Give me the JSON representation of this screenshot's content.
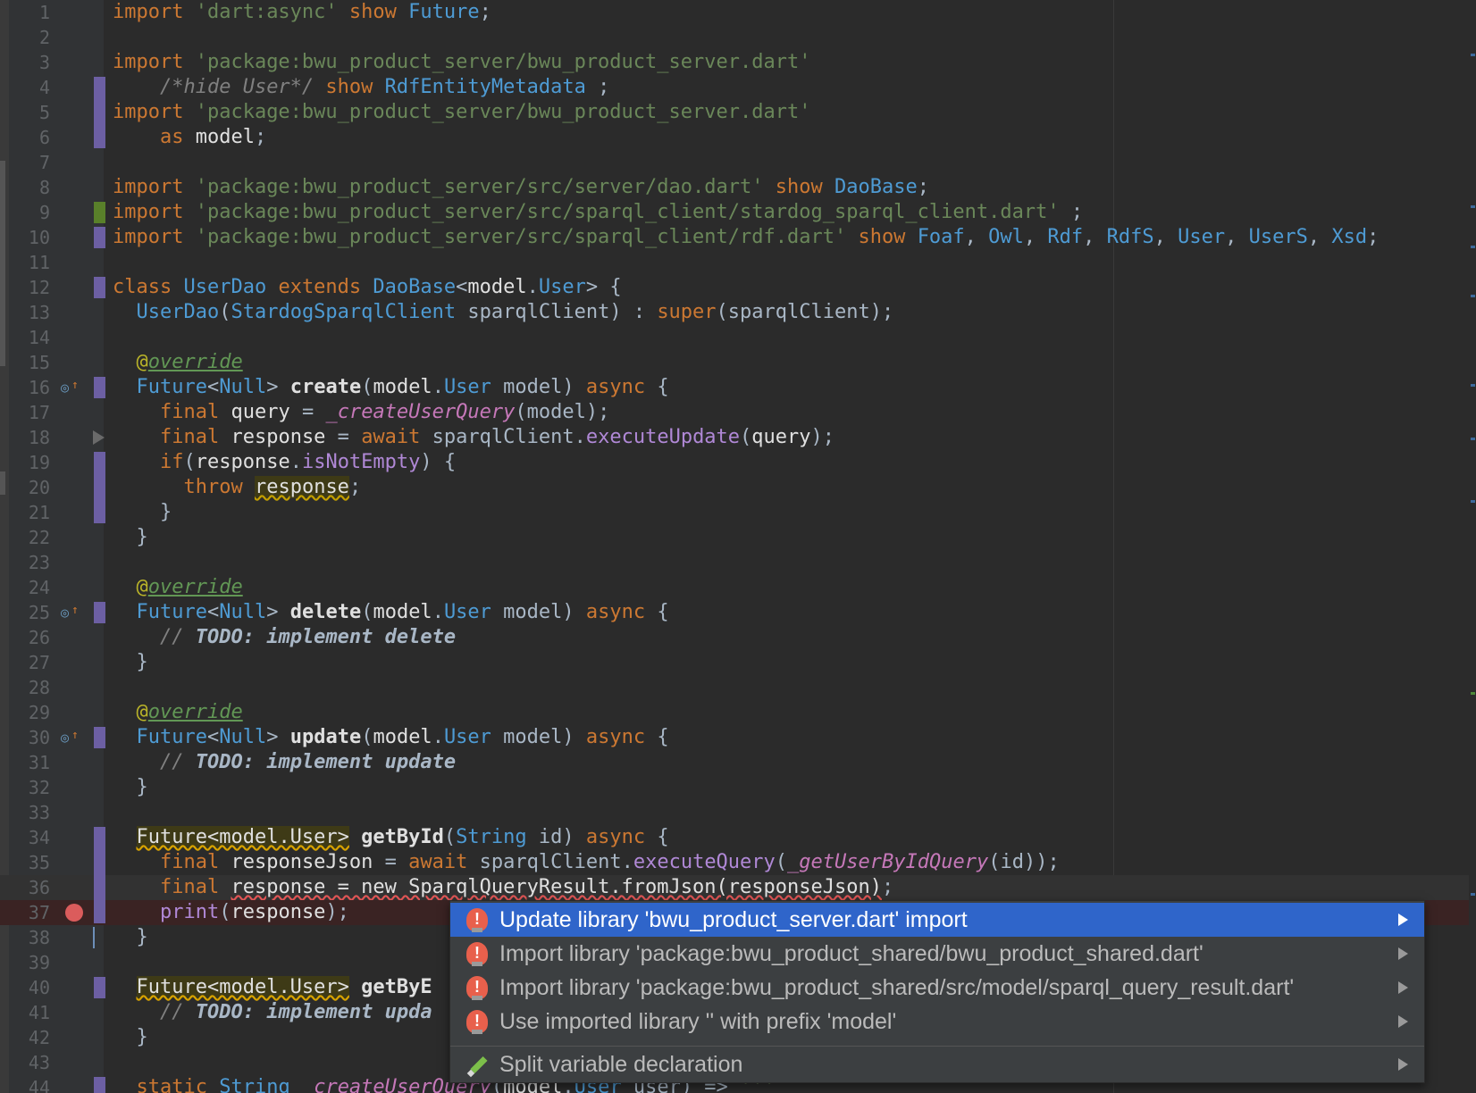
{
  "editor": {
    "lines": [
      {
        "n": "1",
        "tokens": [
          [
            "kw",
            "import "
          ],
          [
            "str",
            "'dart:async'"
          ],
          [
            "kw",
            " show "
          ],
          [
            "cls",
            "Future"
          ],
          [
            "plain",
            ";"
          ]
        ]
      },
      {
        "n": "2",
        "tokens": []
      },
      {
        "n": "3",
        "tokens": [
          [
            "kw",
            "import "
          ],
          [
            "str",
            "'package:bwu_product_server/bwu_product_server.dart'"
          ]
        ]
      },
      {
        "n": "4",
        "tokens": [
          [
            "plain",
            "    "
          ],
          [
            "comment",
            "/*hide User*/"
          ],
          [
            "kw",
            " show "
          ],
          [
            "cls",
            "RdfEntityMetadata"
          ],
          [
            "plain",
            " ;"
          ]
        ]
      },
      {
        "n": "5",
        "tokens": [
          [
            "kw",
            "import "
          ],
          [
            "str",
            "'package:bwu_product_server/bwu_product_server.dart'"
          ]
        ]
      },
      {
        "n": "6",
        "tokens": [
          [
            "plain",
            "    "
          ],
          [
            "kw",
            "as "
          ],
          [
            "white",
            "model"
          ],
          [
            "plain",
            ";"
          ]
        ]
      },
      {
        "n": "7",
        "tokens": []
      },
      {
        "n": "8",
        "tokens": [
          [
            "kw",
            "import "
          ],
          [
            "str",
            "'package:bwu_product_server/src/server/dao.dart'"
          ],
          [
            "kw",
            " show "
          ],
          [
            "cls",
            "DaoBase"
          ],
          [
            "plain",
            ";"
          ]
        ]
      },
      {
        "n": "9",
        "tokens": [
          [
            "kw",
            "import "
          ],
          [
            "str",
            "'package:bwu_product_server/src/sparql_client/stardog_sparql_client.dart'"
          ],
          [
            "plain",
            " ;"
          ]
        ]
      },
      {
        "n": "10",
        "tokens": [
          [
            "kw",
            "import "
          ],
          [
            "str",
            "'package:bwu_product_server/src/sparql_client/rdf.dart'"
          ],
          [
            "kw",
            " show "
          ],
          [
            "cls",
            "Foaf"
          ],
          [
            "plain",
            ", "
          ],
          [
            "cls",
            "Owl"
          ],
          [
            "plain",
            ", "
          ],
          [
            "cls",
            "Rdf"
          ],
          [
            "plain",
            ", "
          ],
          [
            "cls",
            "RdfS"
          ],
          [
            "plain",
            ", "
          ],
          [
            "cls",
            "User"
          ],
          [
            "plain",
            ", "
          ],
          [
            "cls",
            "UserS"
          ],
          [
            "plain",
            ", "
          ],
          [
            "cls",
            "Xsd"
          ],
          [
            "plain",
            ";"
          ]
        ]
      },
      {
        "n": "11",
        "tokens": []
      },
      {
        "n": "12",
        "tokens": [
          [
            "kw",
            "class "
          ],
          [
            "cls",
            "UserDao"
          ],
          [
            "kw",
            " extends "
          ],
          [
            "cls",
            "DaoBase"
          ],
          [
            "plain",
            "<"
          ],
          [
            "white",
            "model"
          ],
          [
            "plain",
            "."
          ],
          [
            "cls",
            "User"
          ],
          [
            "plain",
            "> {"
          ]
        ]
      },
      {
        "n": "13",
        "tokens": [
          [
            "plain",
            "  "
          ],
          [
            "cls",
            "UserDao"
          ],
          [
            "plain",
            "("
          ],
          [
            "cls",
            "StardogSparqlClient"
          ],
          [
            "plain",
            " sparqlClient) : "
          ],
          [
            "kw",
            "super"
          ],
          [
            "plain",
            "(sparqlClient);"
          ]
        ]
      },
      {
        "n": "14",
        "tokens": []
      },
      {
        "n": "15",
        "tokens": [
          [
            "plain",
            "  "
          ],
          [
            "ann",
            "@"
          ],
          [
            "annname",
            "override"
          ]
        ]
      },
      {
        "n": "16",
        "tokens": [
          [
            "plain",
            "  "
          ],
          [
            "cls",
            "Future"
          ],
          [
            "plain",
            "<"
          ],
          [
            "cls",
            "Null"
          ],
          [
            "plain",
            "> "
          ],
          [
            "fn",
            "create"
          ],
          [
            "plain",
            "("
          ],
          [
            "white",
            "model"
          ],
          [
            "plain",
            "."
          ],
          [
            "cls",
            "User"
          ],
          [
            "plain",
            " model) "
          ],
          [
            "kw",
            "async"
          ],
          [
            "plain",
            " {"
          ]
        ]
      },
      {
        "n": "17",
        "tokens": [
          [
            "plain",
            "    "
          ],
          [
            "kw",
            "final "
          ],
          [
            "white",
            "query"
          ],
          [
            "plain",
            " = "
          ],
          [
            "priv",
            "_createUserQuery"
          ],
          [
            "plain",
            "(model);"
          ]
        ]
      },
      {
        "n": "18",
        "tokens": [
          [
            "plain",
            "    "
          ],
          [
            "kw",
            "final "
          ],
          [
            "white",
            "response"
          ],
          [
            "plain",
            " = "
          ],
          [
            "kw",
            "await "
          ],
          [
            "plain",
            "sparqlClient."
          ],
          [
            "call",
            "executeUpdate"
          ],
          [
            "plain",
            "("
          ],
          [
            "white",
            "query"
          ],
          [
            "plain",
            ");"
          ]
        ]
      },
      {
        "n": "19",
        "tokens": [
          [
            "plain",
            "    "
          ],
          [
            "kw",
            "if"
          ],
          [
            "plain",
            "("
          ],
          [
            "white",
            "response"
          ],
          [
            "plain",
            "."
          ],
          [
            "call",
            "isNotEmpty"
          ],
          [
            "plain",
            ") {"
          ]
        ]
      },
      {
        "n": "20",
        "tokens": [
          [
            "plain",
            "      "
          ],
          [
            "kw",
            "throw "
          ],
          [
            "warn",
            "response"
          ],
          [
            "plain",
            ";"
          ]
        ]
      },
      {
        "n": "21",
        "tokens": [
          [
            "plain",
            "    }"
          ]
        ]
      },
      {
        "n": "22",
        "tokens": [
          [
            "plain",
            "  }"
          ]
        ]
      },
      {
        "n": "23",
        "tokens": []
      },
      {
        "n": "24",
        "tokens": [
          [
            "plain",
            "  "
          ],
          [
            "ann",
            "@"
          ],
          [
            "annname",
            "override"
          ]
        ]
      },
      {
        "n": "25",
        "tokens": [
          [
            "plain",
            "  "
          ],
          [
            "cls",
            "Future"
          ],
          [
            "plain",
            "<"
          ],
          [
            "cls",
            "Null"
          ],
          [
            "plain",
            "> "
          ],
          [
            "fn",
            "delete"
          ],
          [
            "plain",
            "("
          ],
          [
            "white",
            "model"
          ],
          [
            "plain",
            "."
          ],
          [
            "cls",
            "User"
          ],
          [
            "plain",
            " model) "
          ],
          [
            "kw",
            "async"
          ],
          [
            "plain",
            " {"
          ]
        ]
      },
      {
        "n": "26",
        "tokens": [
          [
            "plain",
            "    "
          ],
          [
            "comment",
            "// "
          ],
          [
            "todo",
            "TODO: implement delete"
          ]
        ]
      },
      {
        "n": "27",
        "tokens": [
          [
            "plain",
            "  }"
          ]
        ]
      },
      {
        "n": "28",
        "tokens": []
      },
      {
        "n": "29",
        "tokens": [
          [
            "plain",
            "  "
          ],
          [
            "ann",
            "@"
          ],
          [
            "annname",
            "override"
          ]
        ]
      },
      {
        "n": "30",
        "tokens": [
          [
            "plain",
            "  "
          ],
          [
            "cls",
            "Future"
          ],
          [
            "plain",
            "<"
          ],
          [
            "cls",
            "Null"
          ],
          [
            "plain",
            "> "
          ],
          [
            "fn",
            "update"
          ],
          [
            "plain",
            "("
          ],
          [
            "white",
            "model"
          ],
          [
            "plain",
            "."
          ],
          [
            "cls",
            "User"
          ],
          [
            "plain",
            " model) "
          ],
          [
            "kw",
            "async"
          ],
          [
            "plain",
            " {"
          ]
        ]
      },
      {
        "n": "31",
        "tokens": [
          [
            "plain",
            "    "
          ],
          [
            "comment",
            "// "
          ],
          [
            "todo",
            "TODO: implement update"
          ]
        ]
      },
      {
        "n": "32",
        "tokens": [
          [
            "plain",
            "  }"
          ]
        ]
      },
      {
        "n": "33",
        "tokens": []
      },
      {
        "n": "34",
        "tokens": [
          [
            "plain",
            "  "
          ],
          [
            "errtype",
            "Future<model.User>"
          ],
          [
            "plain",
            " "
          ],
          [
            "fn",
            "getById"
          ],
          [
            "plain",
            "("
          ],
          [
            "cls",
            "String"
          ],
          [
            "plain",
            " id) "
          ],
          [
            "kw",
            "async"
          ],
          [
            "plain",
            " {"
          ]
        ]
      },
      {
        "n": "35",
        "tokens": [
          [
            "plain",
            "    "
          ],
          [
            "kw",
            "final "
          ],
          [
            "white",
            "responseJson"
          ],
          [
            "plain",
            " = "
          ],
          [
            "kw",
            "await "
          ],
          [
            "plain",
            "sparqlClient."
          ],
          [
            "call",
            "executeQuery"
          ],
          [
            "plain",
            "("
          ],
          [
            "priv",
            "_getUserByIdQuery"
          ],
          [
            "plain",
            "(id));"
          ]
        ]
      },
      {
        "n": "36",
        "tokens": [
          [
            "plain",
            "    "
          ],
          [
            "kw",
            "final "
          ],
          [
            "err",
            "response = new SparqlQueryResult.fromJson(responseJson)"
          ],
          [
            "plain",
            ";"
          ]
        ]
      },
      {
        "n": "37",
        "tokens": [
          [
            "plain",
            "    "
          ],
          [
            "call",
            "print"
          ],
          [
            "plain",
            "("
          ],
          [
            "white",
            "response"
          ],
          [
            "plain",
            ");"
          ]
        ]
      },
      {
        "n": "38",
        "tokens": [
          [
            "plain",
            "  }"
          ]
        ]
      },
      {
        "n": "39",
        "tokens": []
      },
      {
        "n": "40",
        "tokens": [
          [
            "plain",
            "  "
          ],
          [
            "errtype",
            "Future<model.User>"
          ],
          [
            "plain",
            " "
          ],
          [
            "fn",
            "getByE"
          ]
        ]
      },
      {
        "n": "41",
        "tokens": [
          [
            "plain",
            "    "
          ],
          [
            "comment",
            "// "
          ],
          [
            "todo",
            "TODO: implement upda"
          ]
        ]
      },
      {
        "n": "42",
        "tokens": [
          [
            "plain",
            "  }"
          ]
        ]
      },
      {
        "n": "43",
        "tokens": []
      },
      {
        "n": "44",
        "tokens": [
          [
            "plain",
            "  "
          ],
          [
            "kw",
            "static "
          ],
          [
            "cls",
            "String"
          ],
          [
            "plain",
            " "
          ],
          [
            "priv",
            "_createUserQuery"
          ],
          [
            "plain",
            "("
          ],
          [
            "white",
            "model"
          ],
          [
            "plain",
            "."
          ],
          [
            "cls",
            "User"
          ],
          [
            "plain",
            " user) => "
          ],
          [
            "str",
            "'''"
          ]
        ]
      }
    ]
  },
  "intention_popup": {
    "items": [
      {
        "label": "Update library 'bwu_product_server.dart' import",
        "icon": "error-bulb-icon",
        "selected": true
      },
      {
        "label": "Import library 'package:bwu_product_shared/bwu_product_shared.dart'",
        "icon": "error-bulb-icon",
        "selected": false
      },
      {
        "label": "Import library 'package:bwu_product_shared/src/model/sparql_query_result.dart'",
        "icon": "error-bulb-icon",
        "selected": false
      },
      {
        "label": "Use imported library '' with prefix 'model'",
        "icon": "error-bulb-icon",
        "selected": false
      },
      {
        "label": "Split variable declaration",
        "icon": "pencil-icon",
        "selected": false
      }
    ]
  },
  "colors": {
    "background": "#2b2b2b",
    "gutter": "#313335",
    "keyword": "#cc7832",
    "string": "#6a8759",
    "selection": "#2f65ca"
  }
}
